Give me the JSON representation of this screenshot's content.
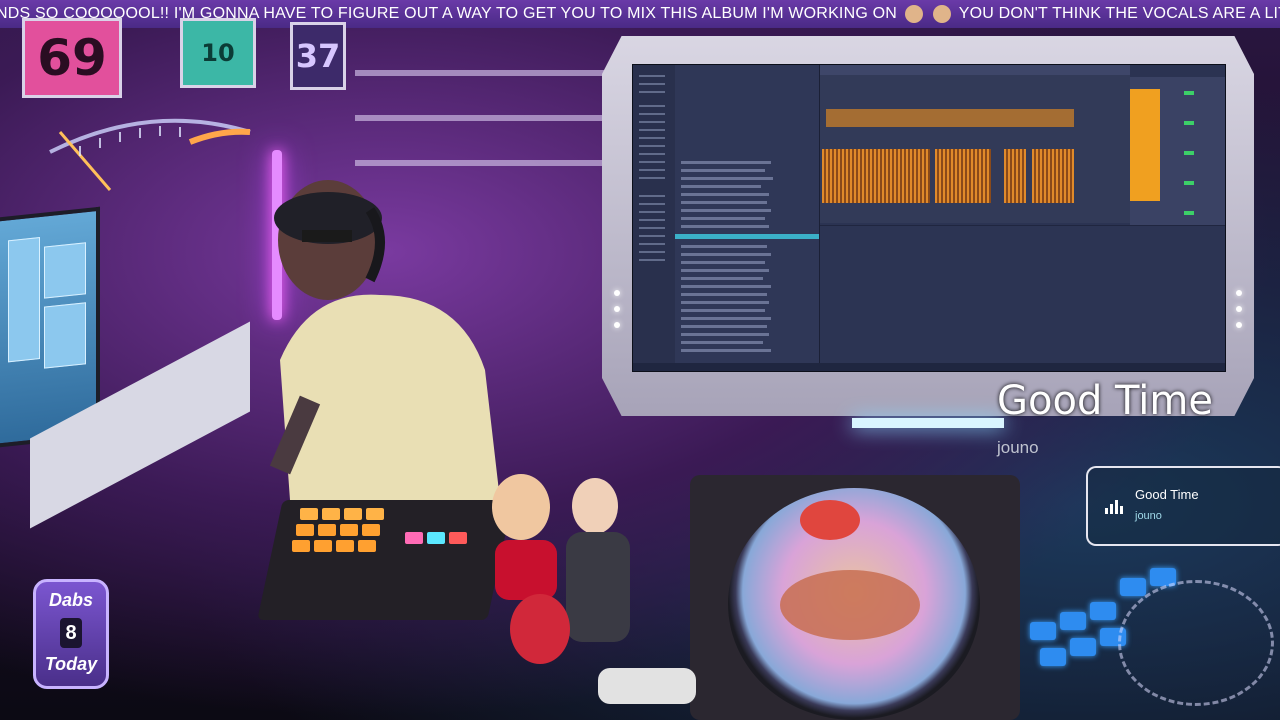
{
  "ticker": {
    "text_part1": "NDS SO COOOOOOL!! I'M GONNA HAVE TO FIGURE OUT A WAY TO GET YOU TO MIX THIS ALBUM I'M WORKING ON",
    "text_part2": "YOU DON'T THINK THE VOCALS ARE A LITTLE LOW? WORD!"
  },
  "wall": {
    "jersey_left": "69",
    "jersey_middle": "10",
    "jersey_right": "37"
  },
  "now_playing": {
    "title": "Good Time",
    "artist": "jouno"
  },
  "now_playing_card": {
    "title": "Good Time",
    "artist": "jouno",
    "icon": "equalizer-bars-icon"
  },
  "badge": {
    "top": "Dabs",
    "number": "8",
    "bottom": "Today"
  },
  "colors": {
    "ticker_bg": "#5a32a0",
    "daw_bg": "#2b3352",
    "clip_orange": "#e08a2a",
    "mixer_orange": "#f0a020"
  }
}
